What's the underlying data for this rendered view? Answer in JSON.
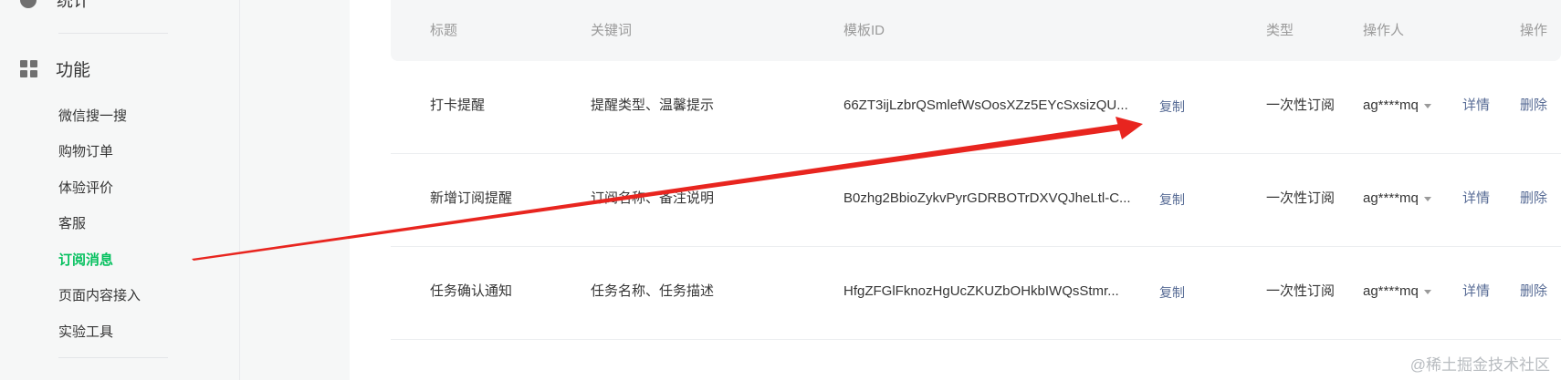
{
  "sidebar": {
    "stats_label": "统计",
    "feature_label": "功能",
    "items": [
      {
        "label": "微信搜一搜"
      },
      {
        "label": "购物订单"
      },
      {
        "label": "体验评价"
      },
      {
        "label": "客服"
      },
      {
        "label": "订阅消息",
        "active": true
      },
      {
        "label": "页面内容接入"
      },
      {
        "label": "实验工具"
      }
    ]
  },
  "table": {
    "headers": {
      "title": "标题",
      "keywords": "关键词",
      "template_id": "模板ID",
      "type": "类型",
      "operator": "操作人",
      "actions": "操作"
    },
    "rows": [
      {
        "title": "打卡提醒",
        "keywords": "提醒类型、温馨提示",
        "template_id": "66ZT3ijLzbrQSmlefWsOosXZz5EYcSxsizQU...",
        "copy": "复制",
        "type": "一次性订阅",
        "operator": "ag****mq",
        "detail": "详情",
        "delete": "删除"
      },
      {
        "title": "新增订阅提醒",
        "keywords": "订阅名称、备注说明",
        "template_id": "B0zhg2BbioZykvPyrGDRBOTrDXVQJheLtl-C...",
        "copy": "复制",
        "type": "一次性订阅",
        "operator": "ag****mq",
        "detail": "详情",
        "delete": "删除"
      },
      {
        "title": "任务确认通知",
        "keywords": "任务名称、任务描述",
        "template_id": "HfgZFGlFknozHgUcZKUZbOHkbIWQsStmr...",
        "copy": "复制",
        "type": "一次性订阅",
        "operator": "ag****mq",
        "detail": "详情",
        "delete": "删除"
      }
    ]
  },
  "watermark": "@稀土掘金技术社区",
  "colors": {
    "accent_active": "#07c160",
    "link": "#576b95",
    "annotation_arrow": "#e8251f"
  },
  "icons": {
    "stats": "pie-chart-icon",
    "feature": "grid-icon",
    "caret": "caret-down-icon"
  }
}
